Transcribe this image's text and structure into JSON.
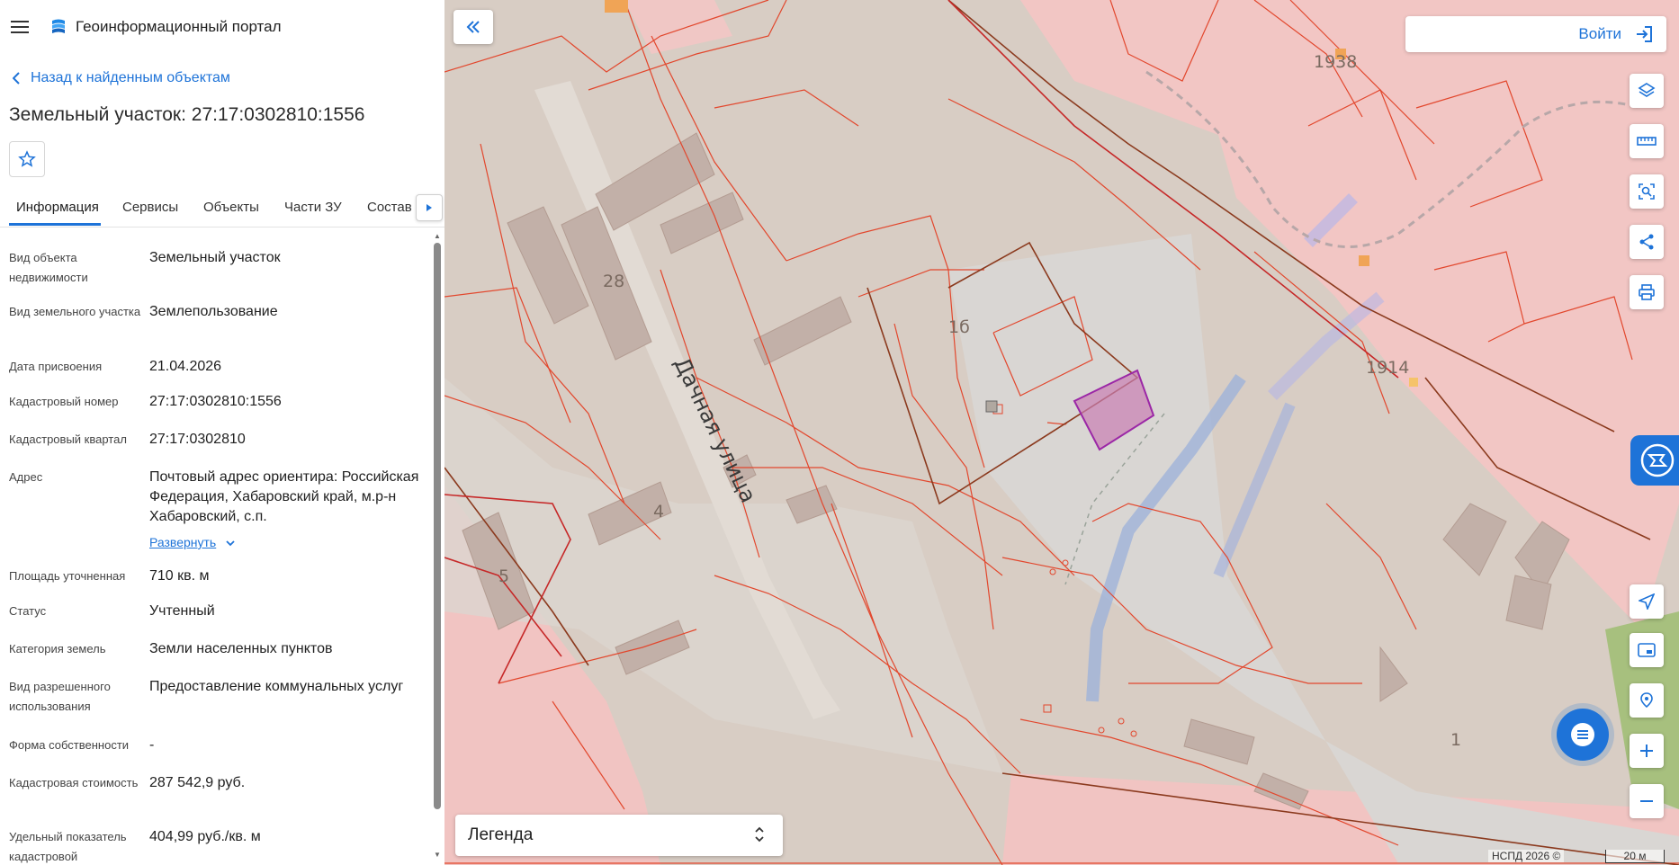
{
  "header": {
    "title": "Геоинформационный портал"
  },
  "nav": {
    "back_label": "Назад к найденным объектам"
  },
  "object": {
    "title": "Земельный участок: 27:17:0302810:1556"
  },
  "tabs": [
    {
      "label": "Информация"
    },
    {
      "label": "Сервисы"
    },
    {
      "label": "Объекты"
    },
    {
      "label": "Части ЗУ"
    },
    {
      "label": "Состав"
    }
  ],
  "info": [
    {
      "label": "Вид объекта недвижимости",
      "value": "Земельный участок"
    },
    {
      "label": "Вид земельного участка",
      "value": "Землепользование"
    },
    {
      "label": "Дата присвоения",
      "value": "21.04.2026"
    },
    {
      "label": "Кадастровый номер",
      "value": "27:17:0302810:1556"
    },
    {
      "label": "Кадастровый квартал",
      "value": "27:17:0302810"
    },
    {
      "label": "Адрес",
      "value": "Почтовый адрес ориентира: Российская Федерация, Хабаровский край, м.р-н Хабаровский, с.п."
    },
    {
      "label": "Площадь уточненная",
      "value": "710 кв. м"
    },
    {
      "label": "Статус",
      "value": "Учтенный"
    },
    {
      "label": "Категория земель",
      "value": "Земли населенных пунктов"
    },
    {
      "label": "Вид разрешенного использования",
      "value": "Предоставление коммунальных услуг"
    },
    {
      "label": "Форма собственности",
      "value": "-"
    },
    {
      "label": "Кадастровая стоимость",
      "value": "287 542,9 руб."
    },
    {
      "label": "Удельный показатель кадастровой",
      "value": "404,99 руб./кв. м"
    }
  ],
  "expand_label": "Развернуть",
  "map": {
    "login_label": "Войти",
    "legend_label": "Легенда",
    "street_name": "Дачная улица",
    "labels": [
      "1938",
      "28",
      "1б",
      "1914",
      "4",
      "5",
      "1"
    ],
    "copyright": "НСПД 2026 ©",
    "scale": "20 м",
    "tools": [
      "layers-icon",
      "ruler-icon",
      "area-select-icon",
      "share-icon",
      "print-icon",
      "locate-icon",
      "picture-in-picture-icon",
      "geo-pin-icon",
      "zoom-in-icon",
      "zoom-out-icon"
    ]
  },
  "colors": {
    "accent": "#1e73d8",
    "parcel": "#e2472d",
    "selected": "#9b27a6"
  }
}
